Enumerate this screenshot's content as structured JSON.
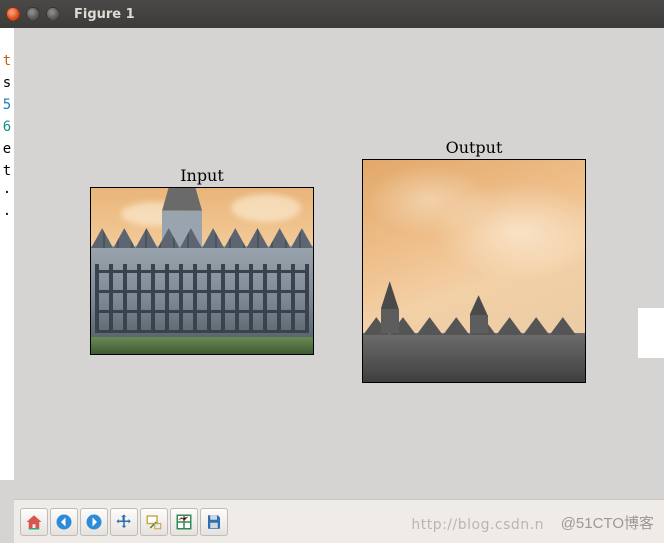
{
  "window": {
    "title": "Figure 1"
  },
  "chart_data": [
    {
      "type": "image",
      "title": "Input",
      "xlim": [
        0,
        1000
      ],
      "ylim": [
        750,
        0
      ],
      "xticks": [
        0,
        200,
        400,
        600,
        800,
        1000
      ],
      "yticks": [
        0,
        100,
        200,
        300,
        400,
        500,
        600,
        700
      ],
      "description": "Photograph of a large Gothic collegiate building with central spired tower under an orange sky, green lawn in foreground"
    },
    {
      "type": "image",
      "title": "Output",
      "xlim": [
        0,
        270
      ],
      "ylim": [
        270,
        0
      ],
      "xticks": [
        0,
        50,
        100,
        150,
        200,
        250
      ],
      "yticks": [
        0,
        50,
        100,
        150,
        200,
        250
      ],
      "description": "Zoomed crop: orange sky with soft clouds, dark roofline and small spires along the bottom"
    }
  ],
  "toolbar": {
    "home": "Home",
    "back": "Back",
    "forward": "Forward",
    "pan": "Pan",
    "zoom": "Zoom",
    "subplots": "Configure subplots",
    "save": "Save"
  },
  "watermark": {
    "wm1": "http://blog.csdn.n",
    "wm2": "@51CTO博客"
  },
  "code_peek": [
    "t",
    "s",
    "",
    "5",
    "6",
    "e",
    "t",
    "",
    "·",
    "·"
  ]
}
